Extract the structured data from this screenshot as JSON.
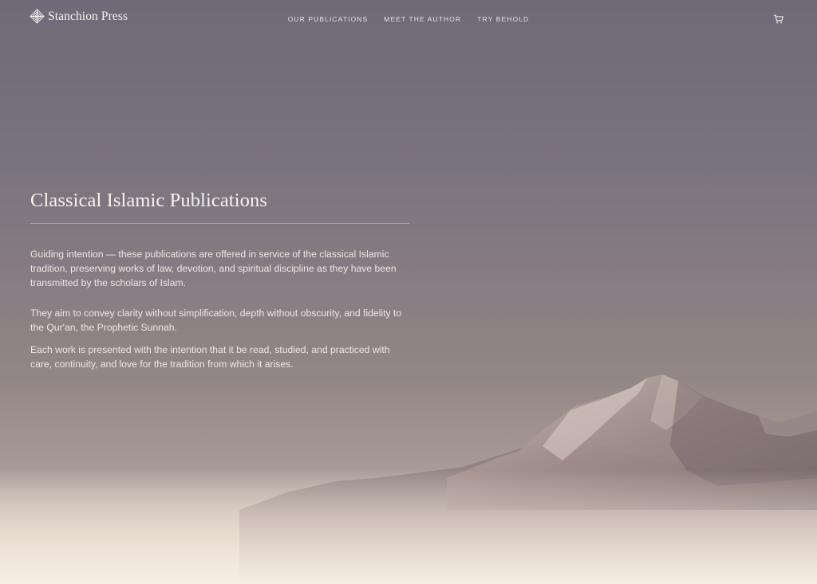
{
  "header": {
    "brand_name": "Stanchion Press",
    "nav": [
      {
        "label": "OUR PUBLICATIONS"
      },
      {
        "label": "MEET THE AUTHOR"
      },
      {
        "label": "TRY BEHOLD"
      }
    ],
    "cart_icon": "cart-icon"
  },
  "hero": {
    "title": "Classical Islamic Publications",
    "paragraphs": [
      "Guiding intention — these publications are offered in service of the classical Islamic tradition, preserving works of law, devotion, and spiritual discipline as they have been transmitted by the scholars of Islam.",
      "They aim to convey clarity without simplification, depth without obscurity, and fidelity to the Qur'an, the Prophetic Sunnah.",
      "Each work is presented with the intention that it be read, studied, and practiced with care, continuity, and love for the tradition from which it arises."
    ]
  },
  "colors": {
    "sky_top": "#6e6a77",
    "sky_mid": "#847b82",
    "haze": "#f4eadf",
    "text": "#f3eeeb"
  }
}
